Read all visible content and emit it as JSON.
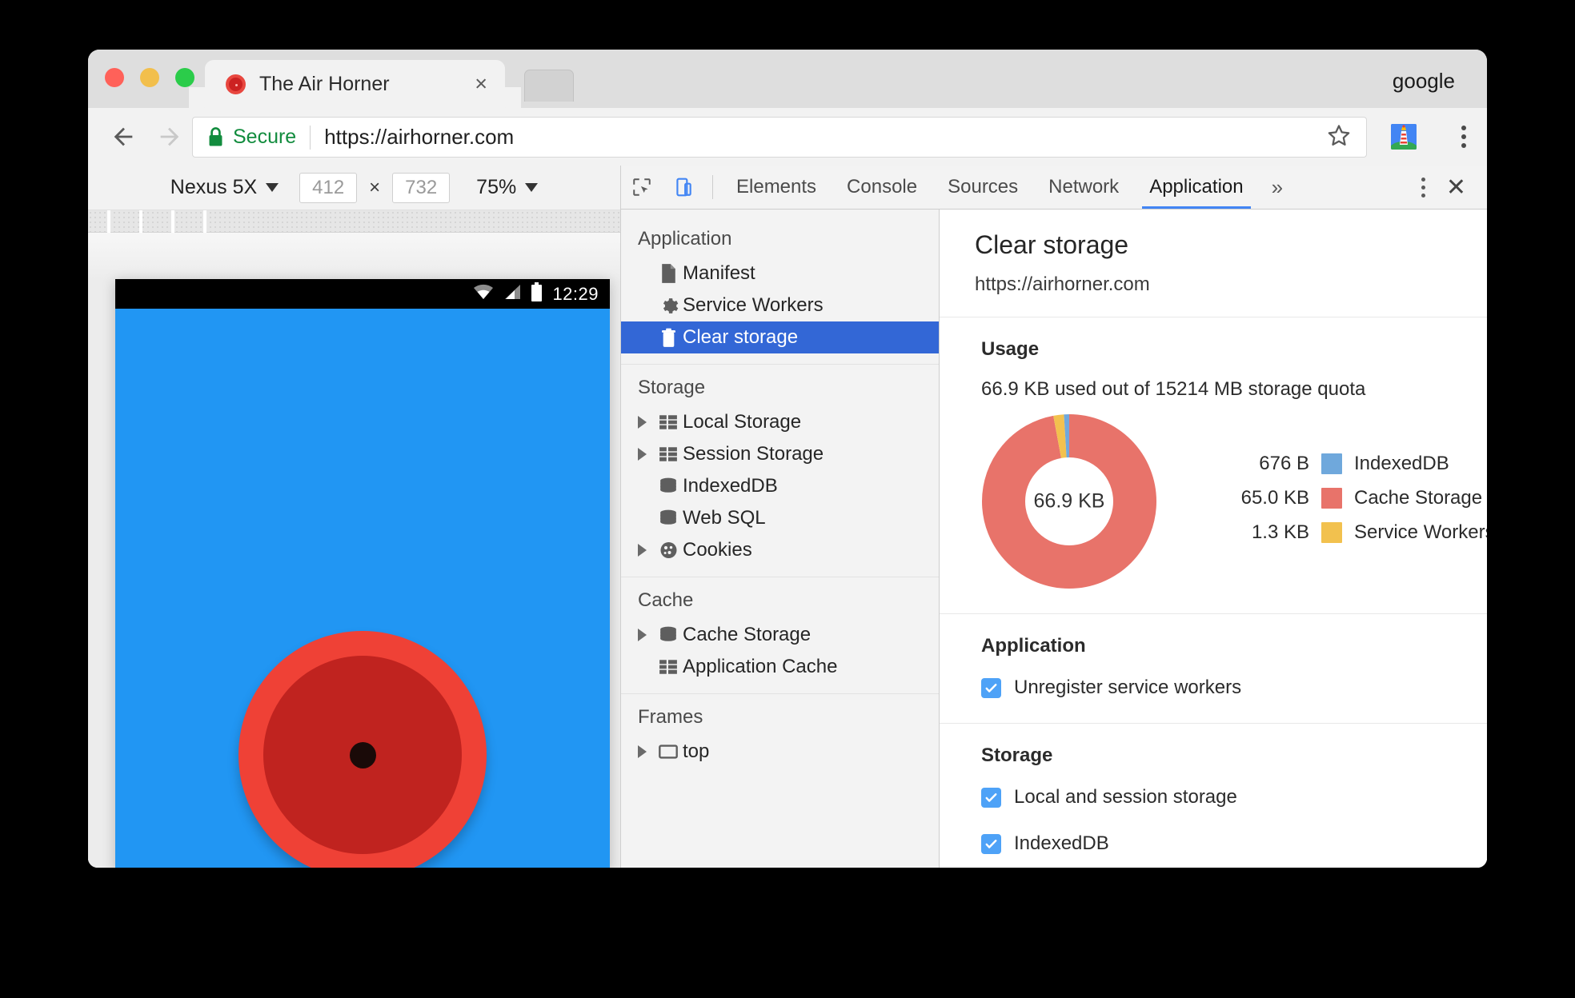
{
  "window": {
    "profile_name": "google",
    "traffic_lights": [
      "close-red",
      "minimize-yellow",
      "maximize-green"
    ]
  },
  "tab": {
    "title": "The Air Horner",
    "close_label": "×",
    "favicon": "airhorn-favicon"
  },
  "omnibox": {
    "secure_label": "Secure",
    "url_scheme": "https://",
    "url_host": "airhorner.com",
    "url_full": "https://airhorner.com",
    "star_icon": "bookmark-star-icon",
    "extension_icon": "lighthouse-extension-icon",
    "menu_icon": "chrome-menu-icon",
    "back_icon": "back-arrow-icon",
    "forward_icon": "forward-arrow-icon",
    "reload_icon": "reload-icon"
  },
  "device_toolbar": {
    "device_name": "Nexus 5X",
    "width": "412",
    "height": "732",
    "multiply": "×",
    "zoom": "75%"
  },
  "device_screen": {
    "status_time": "12:29",
    "status_icons": [
      "wifi-icon",
      "signal-icon",
      "battery-icon"
    ],
    "background_color": "#2196f3",
    "horn_outer_color": "#ef4136",
    "horn_inner_color": "#c0231f"
  },
  "devtools": {
    "inspect_icon": "inspect-element-icon",
    "device_toggle_icon": "toggle-device-toolbar-icon",
    "tabs": [
      {
        "label": "Elements",
        "active": false
      },
      {
        "label": "Console",
        "active": false
      },
      {
        "label": "Sources",
        "active": false
      },
      {
        "label": "Network",
        "active": false
      },
      {
        "label": "Application",
        "active": true
      }
    ],
    "overflow_label": "»",
    "kebab_icon": "devtools-more-options-icon",
    "close_label": "✕",
    "accent_color": "#4285f4"
  },
  "sidebar": {
    "groups": [
      {
        "title": "Application",
        "items": [
          {
            "label": "Manifest",
            "icon": "document-icon",
            "arrow": false,
            "selected": false
          },
          {
            "label": "Service Workers",
            "icon": "gear-icon",
            "arrow": false,
            "selected": false
          },
          {
            "label": "Clear storage",
            "icon": "trash-icon",
            "arrow": false,
            "selected": true
          }
        ]
      },
      {
        "title": "Storage",
        "items": [
          {
            "label": "Local Storage",
            "icon": "table-icon",
            "arrow": true,
            "selected": false
          },
          {
            "label": "Session Storage",
            "icon": "table-icon",
            "arrow": true,
            "selected": false
          },
          {
            "label": "IndexedDB",
            "icon": "database-icon",
            "arrow": false,
            "selected": false
          },
          {
            "label": "Web SQL",
            "icon": "database-icon",
            "arrow": false,
            "selected": false
          },
          {
            "label": "Cookies",
            "icon": "cookie-icon",
            "arrow": true,
            "selected": false
          }
        ]
      },
      {
        "title": "Cache",
        "items": [
          {
            "label": "Cache Storage",
            "icon": "database-icon",
            "arrow": true,
            "selected": false
          },
          {
            "label": "Application Cache",
            "icon": "table-icon",
            "arrow": false,
            "selected": false
          }
        ]
      },
      {
        "title": "Frames",
        "items": [
          {
            "label": "top",
            "icon": "frame-icon",
            "arrow": true,
            "selected": false
          }
        ]
      }
    ],
    "selected_bg": "#3367d6"
  },
  "panel": {
    "title": "Clear storage",
    "origin": "https://airhorner.com",
    "usage": {
      "section_title": "Usage",
      "summary": "66.9 KB used out of 15214 MB storage quota",
      "center_label": "66.9 KB"
    },
    "application": {
      "section_title": "Application",
      "checkboxes": [
        {
          "label": "Unregister service workers",
          "checked": true
        }
      ]
    },
    "storage": {
      "section_title": "Storage",
      "checkboxes": [
        {
          "label": "Local and session storage",
          "checked": true
        },
        {
          "label": "IndexedDB",
          "checked": true
        }
      ]
    }
  },
  "chart_data": {
    "type": "pie",
    "title": "Usage",
    "subtitle": "66.9 KB used out of 15214 MB storage quota",
    "center_label": "66.9 KB",
    "donut": true,
    "legend_position": "right",
    "categories": [
      "IndexedDB",
      "Cache Storage",
      "Service Workers"
    ],
    "value_labels": [
      "676 B",
      "65.0 KB",
      "1.3 KB"
    ],
    "values": [
      0.676,
      65.0,
      1.3
    ],
    "units": "KB",
    "total": 66.9,
    "colors": [
      "#6fa8dc",
      "#e8736a",
      "#f2c14e"
    ],
    "segments": [
      {
        "name": "IndexedDB",
        "value": 0.676,
        "label": "676 B",
        "color": "#6fa8dc",
        "percent": 1.0
      },
      {
        "name": "Cache Storage",
        "value": 65.0,
        "label": "65.0 KB",
        "color": "#e8736a",
        "percent": 97.1
      },
      {
        "name": "Service Workers",
        "value": 1.3,
        "label": "1.3 KB",
        "color": "#f2c14e",
        "percent": 1.9
      }
    ]
  }
}
